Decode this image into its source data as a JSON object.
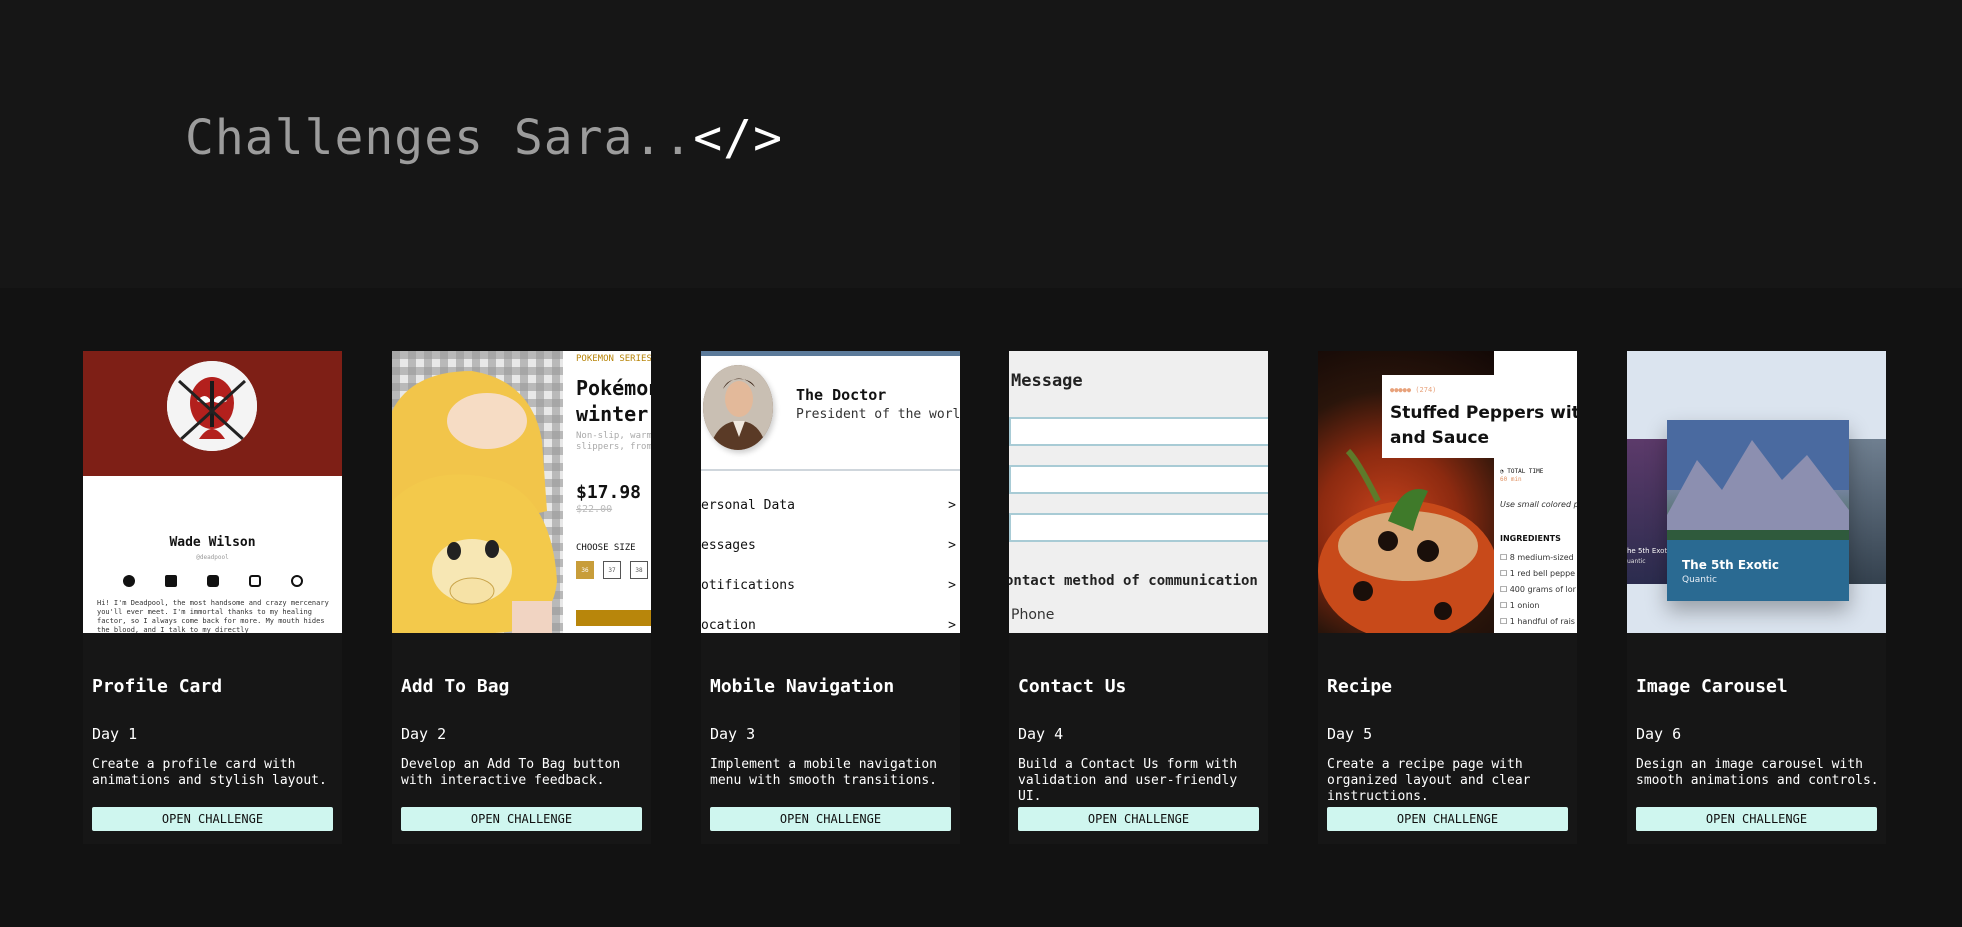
{
  "header": {
    "title": "Challenges Sara",
    "dots": "..",
    "code": "</>"
  },
  "theme": {
    "background": "#141414",
    "title_gray": "#9c9c9c",
    "button_bg": "#cff6ef"
  },
  "cards": [
    {
      "title": "Profile Card",
      "day": "Day 1",
      "description": "Create a profile card with animations and stylish layout.",
      "button": "OPEN CHALLENGE",
      "preview": {
        "name": "Wade Wilson",
        "handle": "@deadpool",
        "bio": "Hi! I'm Deadpool, the most handsome and crazy mercenary you'll ever meet. I'm immortal thanks to my healing factor, so I always come back for more. My mouth hides the blood, and I talk to my directly"
      }
    },
    {
      "title": "Add To Bag",
      "day": "Day 2",
      "description": "Develop an Add To Bag button with interactive feedback.",
      "button": "OPEN CHALLENGE",
      "preview": {
        "series": "POKEMON SERIES",
        "product_line1": "Pokémon",
        "product_line2": "winter",
        "desc_line1": "Non-slip, warm",
        "desc_line2": "slippers, from",
        "price": "$17.98",
        "old_price": "$22.00",
        "size_label": "CHOOSE SIZE",
        "sizes": [
          "36",
          "37",
          "38"
        ]
      }
    },
    {
      "title": "Mobile Navigation",
      "day": "Day 3",
      "description": "Implement a mobile navigation menu with smooth transitions.",
      "button": "OPEN CHALLENGE",
      "preview": {
        "name": "The Doctor",
        "role": "President of the world",
        "items": [
          "ersonal Data",
          "essages",
          "otifications",
          "ocation"
        ],
        "chevron": ">"
      }
    },
    {
      "title": "Contact Us",
      "day": "Day 4",
      "description": "Build a Contact Us form with validation and user-friendly UI.",
      "button": "OPEN CHALLENGE",
      "preview": {
        "title": "Message",
        "method": "ontact method of communication",
        "phone": "Phone"
      }
    },
    {
      "title": "Recipe",
      "day": "Day 5",
      "description": "Create a recipe page with organized layout and clear instructions.",
      "button": "OPEN CHALLENGE",
      "preview": {
        "rating": "(274)",
        "title_line1": "Stuffed Peppers with",
        "title_line2": "and Sauce",
        "time_label": "TOTAL TIME",
        "time_value": "60 min",
        "note": "Use small colored p",
        "ingredients_label": "INGREDIENTS",
        "ingredients": [
          "8 medium-sized",
          "1 red bell peppe",
          "400 grams of lor",
          "1 onion",
          "1 handful of rais"
        ]
      }
    },
    {
      "title": "Image Carousel",
      "day": "Day 6",
      "description": "Design an image carousel with smooth animations and controls.",
      "button": "OPEN CHALLENGE",
      "preview": {
        "caption": "The 5th Exotic",
        "subcaption": "Quantic",
        "side_caption": "he 5th Exotic",
        "side_subcaption": "uantic"
      }
    }
  ]
}
